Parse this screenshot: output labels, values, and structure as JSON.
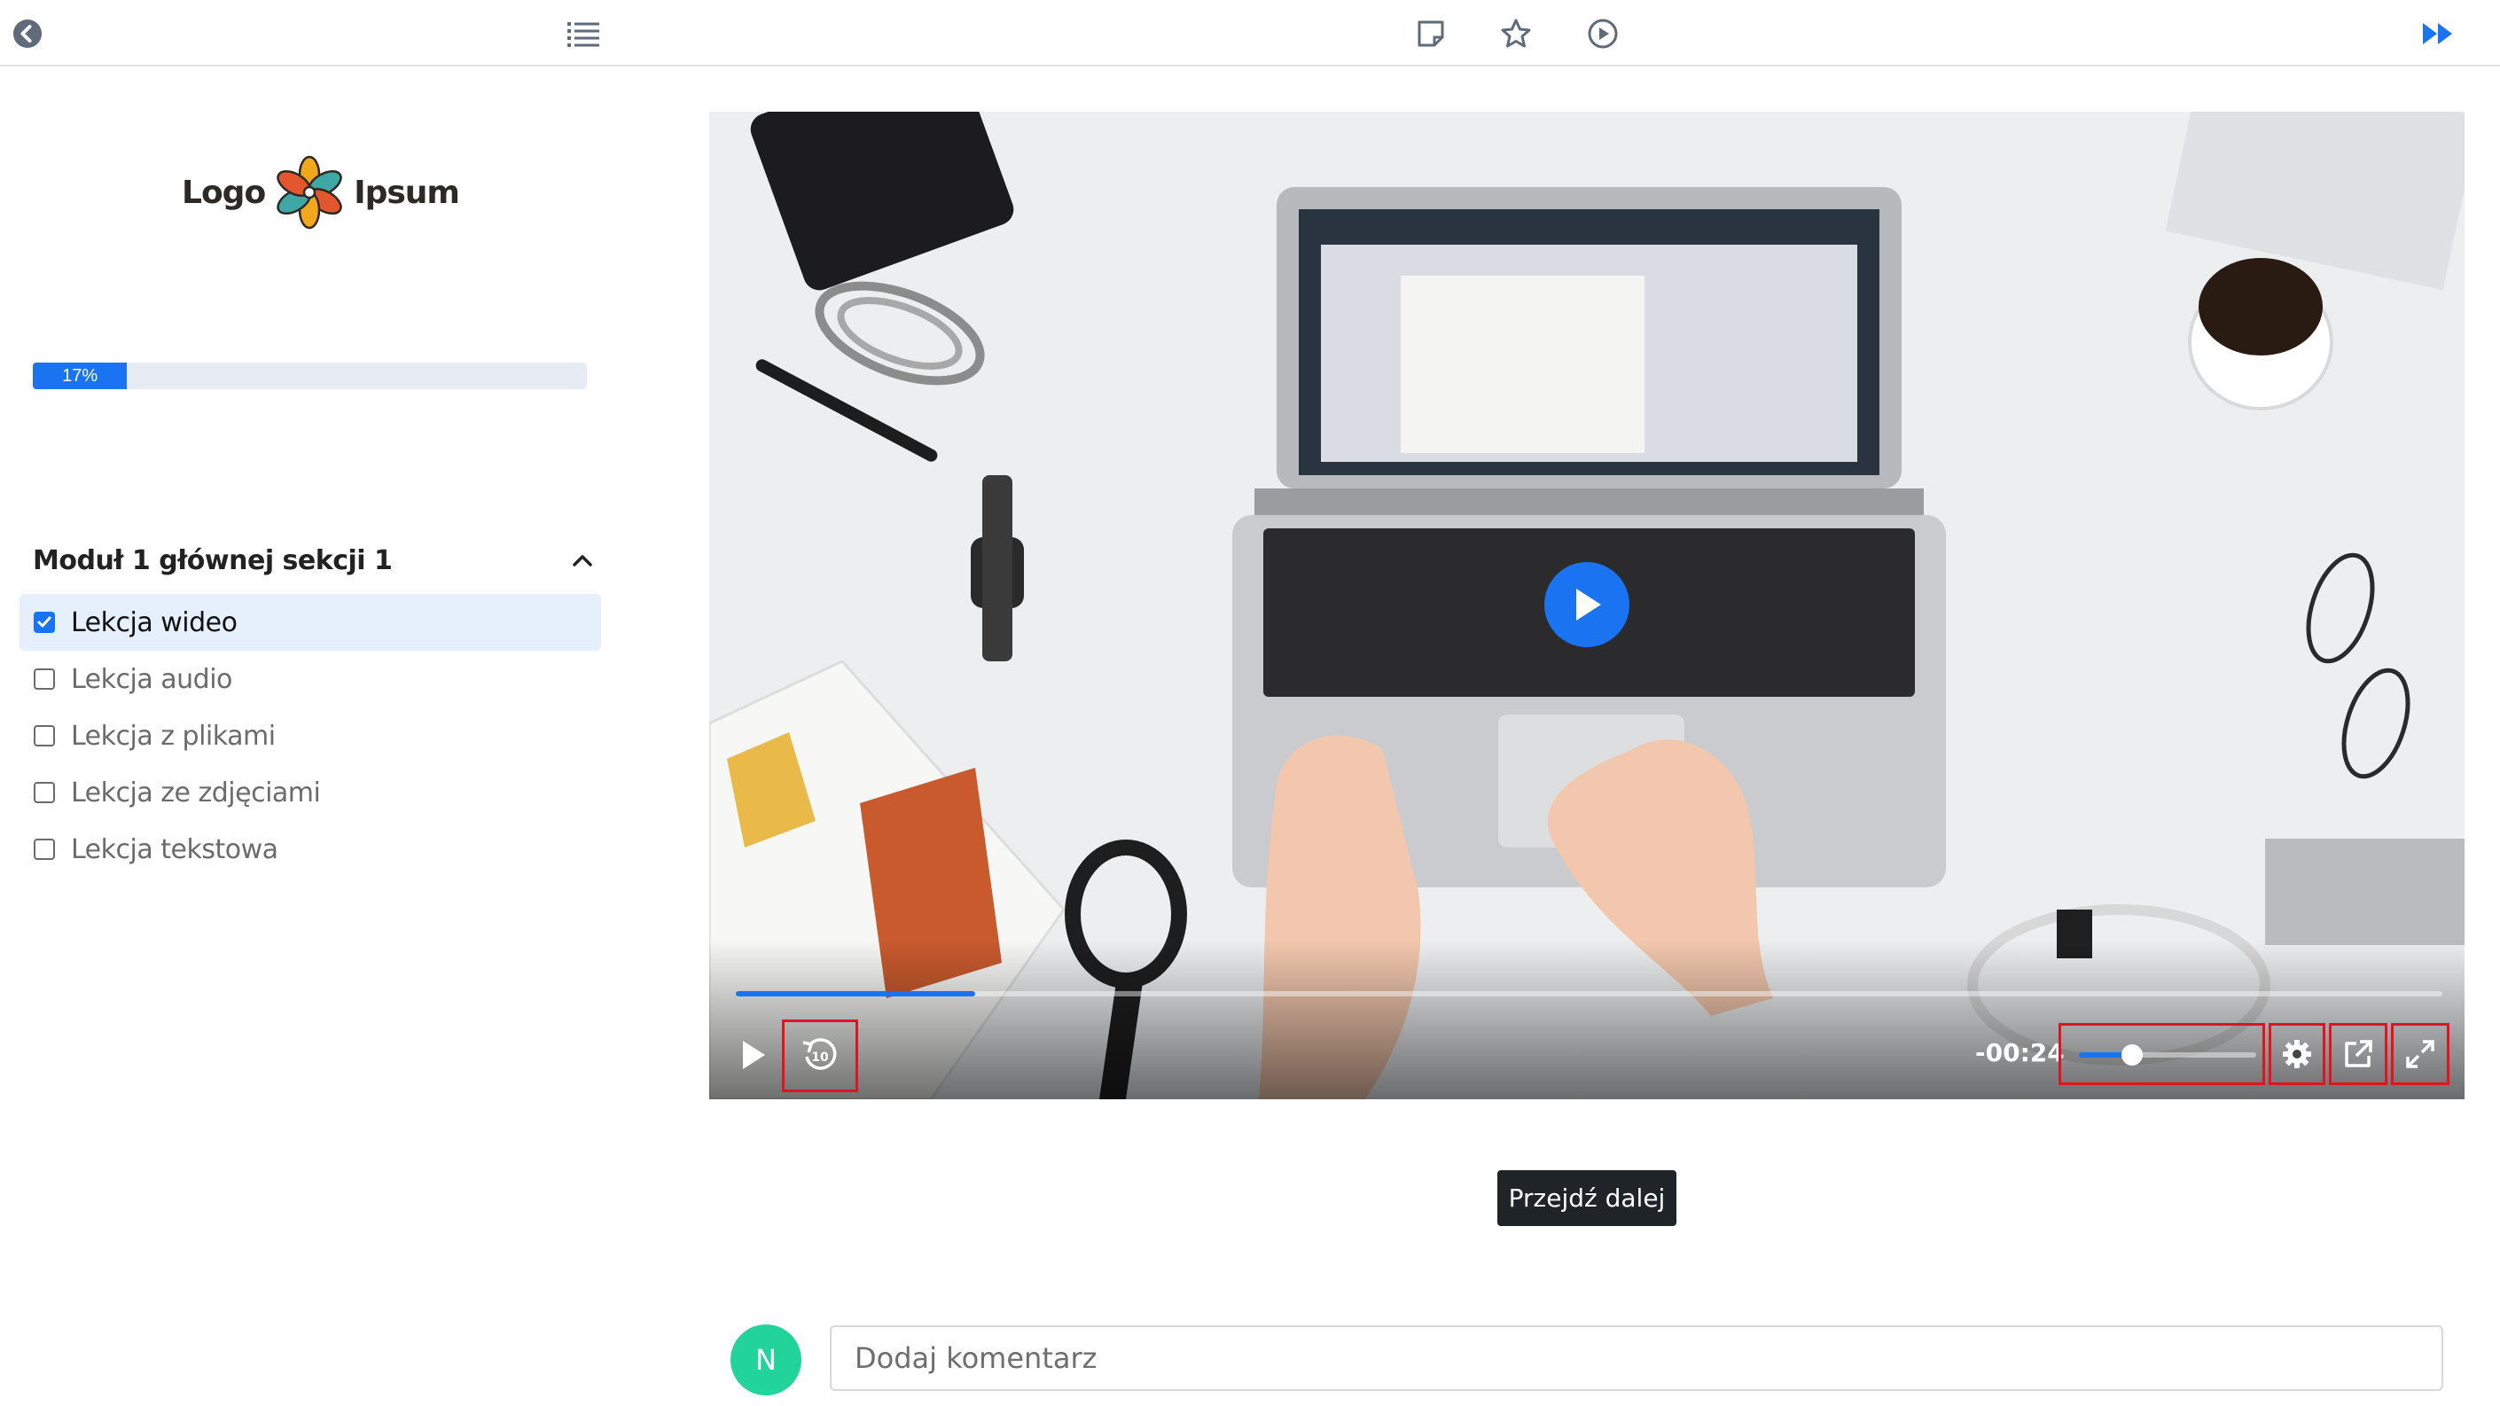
{
  "topbar": {
    "back_icon": "back-circle-icon",
    "list_icon": "list-icon",
    "note_icon": "note-icon",
    "star_icon": "star-icon",
    "play_icon": "play-circle-icon",
    "forward_icon": "fast-forward-icon",
    "accent": "#1a73f0"
  },
  "sidebar": {
    "logo_left": "Logo",
    "logo_right": "Ipsum",
    "progress_label": "17%",
    "progress_value": 0.17,
    "module_title": "Moduł 1 głównej sekcji 1",
    "lessons": [
      {
        "label": "Lekcja wideo",
        "checked": true
      },
      {
        "label": "Lekcja audio",
        "checked": false
      },
      {
        "label": "Lekcja z plikami",
        "checked": false
      },
      {
        "label": "Lekcja ze zdjęciami",
        "checked": false
      },
      {
        "label": "Lekcja tekstowa",
        "checked": false
      }
    ]
  },
  "video": {
    "time_remaining": "-00:24",
    "played_fraction": 0.14,
    "volume_fraction": 0.3,
    "icons": [
      "play-icon",
      "rewind-10-icon",
      "gear-icon",
      "external-link-icon",
      "fullscreen-icon"
    ]
  },
  "next_button": "Przejdź dalej",
  "comment": {
    "avatar_letter": "N",
    "placeholder": "Dodaj komentarz"
  }
}
